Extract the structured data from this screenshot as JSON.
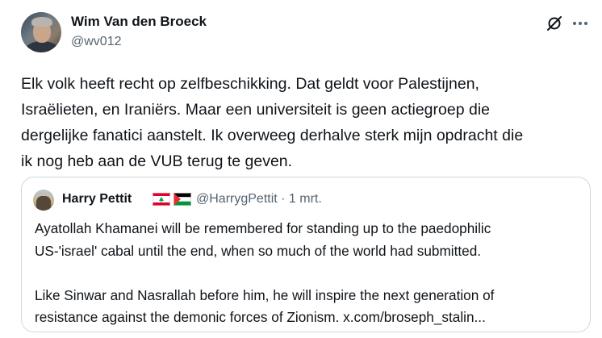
{
  "author": {
    "name": "Wim Van den Broeck",
    "handle": "@wv012"
  },
  "actions": {
    "grok_icon": "grok-icon",
    "more_icon": "more-dots-icon"
  },
  "tweet": {
    "lines": [
      "Elk volk heeft recht op zelfbeschikking. Dat geldt voor Palestijnen,",
      "Israëlieten, en Iraniërs. Maar een universiteit is geen actiegroep die",
      "dergelijke fanatici aanstelt. Ik overweeg derhalve sterk mijn opdracht die",
      "ik nog heb aan de VUB terug te geven."
    ]
  },
  "quote": {
    "name": "Harry Pettit",
    "flags": [
      "lebanon-flag",
      "palestine-flag"
    ],
    "handle_time": "@HarrygPettit · 1 mrt.",
    "lines": [
      "Ayatollah Khamanei will be remembered for standing up to the paedophilic",
      "US-'israel' cabal until the end, when so much of the world had submitted.",
      "",
      "Like Sinwar and Nasrallah before him, he will inspire the next generation of",
      "resistance against the demonic forces of Zionism. x.com/broseph_stalin..."
    ]
  },
  "colors": {
    "text": "#0f1419",
    "secondary": "#536471",
    "border": "#cfd9de"
  }
}
